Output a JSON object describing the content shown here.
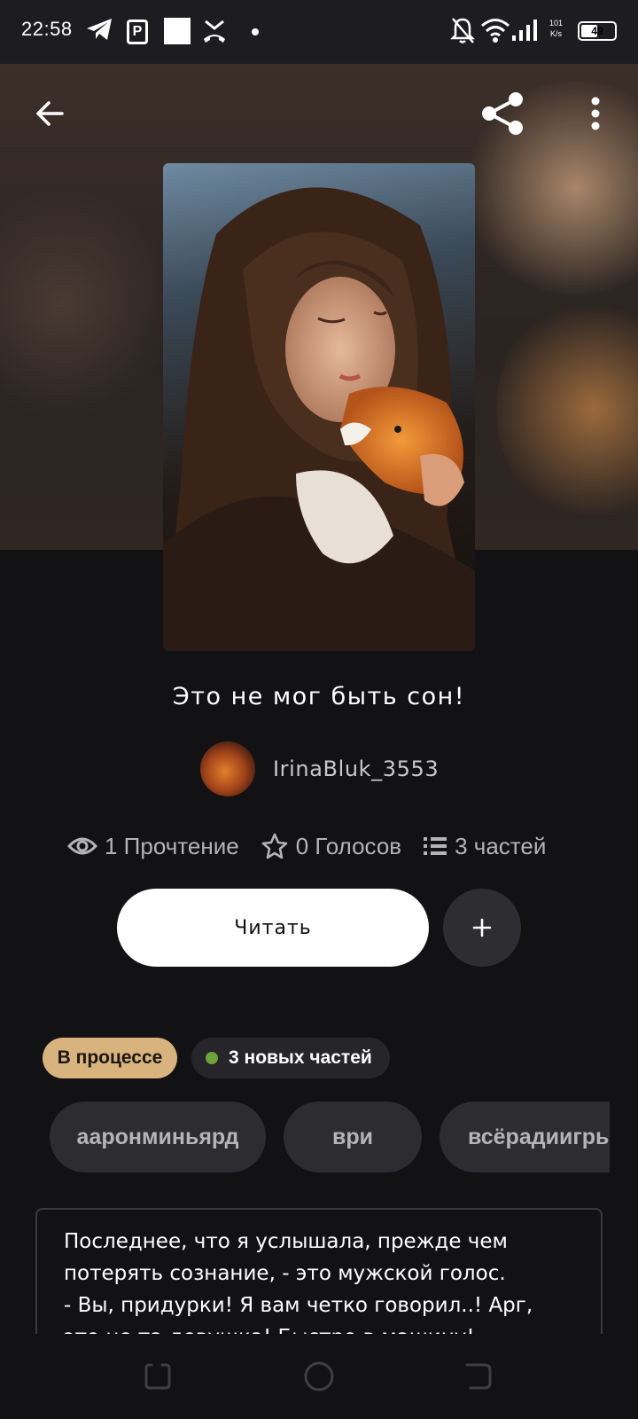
{
  "status_bar": {
    "time": "22:58",
    "speed_value": "101",
    "speed_unit": "K/s",
    "battery": "49",
    "battery_level": 0.49
  },
  "header": {
    "back_icon": "arrow-left-icon",
    "share_icon": "share-icon",
    "more_icon": "more-vertical-icon"
  },
  "story": {
    "title": "Это не мог быть сон!",
    "author": "IrinaBluk_3553",
    "stats": {
      "reads": "1 Прочтение",
      "votes": "0 Голосов",
      "parts": "3 частей"
    },
    "read_label": "Читать",
    "add_label": "+",
    "status_badge": "В процессе",
    "new_parts_badge": "3 новых частей",
    "tags": [
      "аaронминьярд",
      "ври",
      "всёрадиигры"
    ],
    "description": "Последнее, что я услышала, прежде чем потерять сознание, - это мужской голос.\n- Вы, придурки! Я вам четко говорил..! Арг, это не та девушка! Быстро в машину!"
  },
  "colors": {
    "background": "#121114",
    "badge_progress": "#d8b37d",
    "new_parts_dot": "#6ea23a",
    "tag_bg": "#2d2c31"
  }
}
